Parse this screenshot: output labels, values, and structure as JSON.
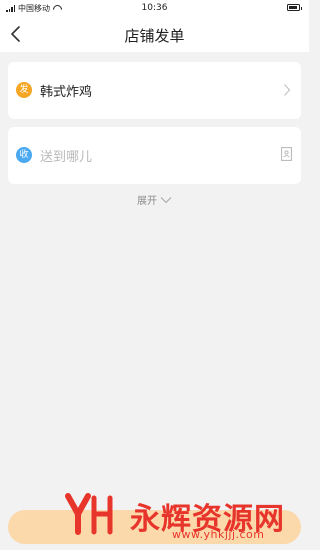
{
  "status_bar": {
    "carrier": "中国移动",
    "time": "10:36"
  },
  "header": {
    "title": "店铺发单"
  },
  "shop_card": {
    "badge": "发",
    "name": "韩式炸鸡"
  },
  "destination_card": {
    "badge": "收",
    "placeholder": "送到哪儿"
  },
  "expand": {
    "label": "展开"
  },
  "watermark": {
    "title": "永辉资源网",
    "url": "www.yhkjjj.com"
  },
  "colors": {
    "send_badge": "#f5a623",
    "receive_badge": "#4aa9f0",
    "bottom_button": "#fbd9ab",
    "watermark": "#e8352b"
  }
}
